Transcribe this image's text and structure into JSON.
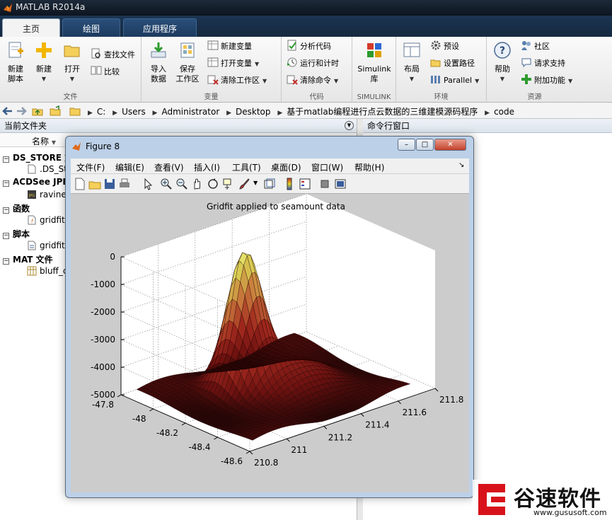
{
  "window": {
    "title": "MATLAB R2014a"
  },
  "tabs": [
    {
      "label": "主页",
      "active": true
    },
    {
      "label": "绘图",
      "active": false
    },
    {
      "label": "应用程序",
      "active": false
    }
  ],
  "ribbon": {
    "file": {
      "label": "文件",
      "new_script": "新建\n脚本",
      "new": "新建",
      "open": "打开",
      "find_files": "查找文件",
      "compare": "比较"
    },
    "variable": {
      "label": "变量",
      "import": "导入\n数据",
      "save_ws": "保存\n工作区",
      "new_var": "新建变量",
      "open_var": "打开变量",
      "clear_ws": "清除工作区"
    },
    "code": {
      "label": "代码",
      "analyze": "分析代码",
      "run_time": "运行和计时",
      "clear_cmd": "清除命令"
    },
    "simulink": {
      "label": "SIMULINK",
      "lib": "Simulink\n库"
    },
    "environment": {
      "label": "环境",
      "layout": "布局",
      "prefs": "预设",
      "set_path": "设置路径",
      "parallel": "Parallel"
    },
    "resources": {
      "label": "资源",
      "help": "帮助",
      "community": "社区",
      "support": "请求支持",
      "addons": "附加功能"
    }
  },
  "address": {
    "drive": "C:",
    "crumbs": [
      "Users",
      "Administrator",
      "Desktop",
      "基于matlab编程进行点云数据的三维建模源码程序",
      "code"
    ]
  },
  "current_folder": {
    "title": "当前文件夹",
    "column": "名称",
    "groups": [
      {
        "label": "DS_STORE 文",
        "items": [
          ".DS_St"
        ]
      },
      {
        "label": "ACDSee JPE",
        "items": [
          "ravine"
        ]
      },
      {
        "label": "函数",
        "items": [
          "gridfit"
        ]
      },
      {
        "label": "脚本",
        "items": [
          "gridfit"
        ]
      },
      {
        "label": "MAT 文件",
        "items": [
          "bluff_c"
        ]
      }
    ]
  },
  "command_window": {
    "title": "命令行窗口"
  },
  "figure": {
    "title": "Figure 8",
    "menus": [
      "文件(F)",
      "编辑(E)",
      "查看(V)",
      "插入(I)",
      "工具(T)",
      "桌面(D)",
      "窗口(W)",
      "帮助(H)"
    ],
    "plot_title": "Gridfit applied to seamount data",
    "z_ticks": [
      "0",
      "-1000",
      "-2000",
      "-3000",
      "-4000",
      "-5000"
    ],
    "y_ticks": [
      "-47.8",
      "-48",
      "-48.2",
      "-48.4",
      "-48.6"
    ],
    "x_ticks": [
      "210.8",
      "211",
      "211.2",
      "211.4",
      "211.6",
      "211.8"
    ]
  },
  "watermark": {
    "brand": "谷速软件",
    "url": "www.gususoft.com"
  },
  "colors": {
    "titlebar": "#0d1520",
    "tab_active": "#f3f3f3",
    "surface_peak": "#c9c23a",
    "surface_base": "#3a0a08",
    "watermark_red": "#d8121b"
  }
}
